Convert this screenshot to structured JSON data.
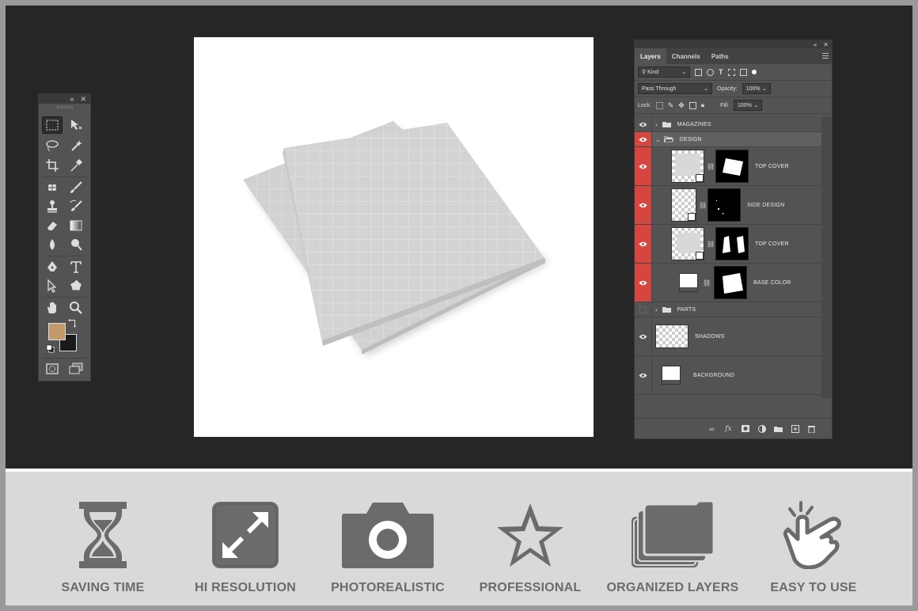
{
  "toolbox": {
    "collapse_icon": "double-chevron-icon",
    "close_icon": "close-icon",
    "foreground_color": "#c49a6c",
    "background_color": "#1a1a1a"
  },
  "layers_panel": {
    "tabs": [
      {
        "label": "Layers",
        "active": true
      },
      {
        "label": "Channels",
        "active": false
      },
      {
        "label": "Paths",
        "active": false
      }
    ],
    "filter_kind": "Kind",
    "blend_mode": "Pass Through",
    "opacity_label": "Opacity:",
    "opacity_value": "100%",
    "lock_label": "Lock:",
    "fill_label": "Fill:",
    "fill_value": "100%",
    "layers": [
      {
        "name": "MAGAZINES",
        "type": "group",
        "open": false,
        "visible": true
      },
      {
        "name": "DESIGN",
        "type": "group",
        "open": true,
        "visible": true
      },
      {
        "name": "TOP COVER",
        "type": "smart",
        "visible": true
      },
      {
        "name": "SIDE DESIGN",
        "type": "smart",
        "visible": true
      },
      {
        "name": "TOP COVER",
        "type": "smart",
        "visible": true
      },
      {
        "name": "BASE COLOR",
        "type": "fill",
        "visible": true
      },
      {
        "name": "PARTS",
        "type": "group",
        "open": false,
        "visible": false
      },
      {
        "name": "SHADOWS",
        "type": "layer",
        "visible": true
      },
      {
        "name": "BACKGROUND",
        "type": "fill",
        "visible": true
      }
    ],
    "accent_color": "#d4463f"
  },
  "features": [
    {
      "label": "SAVING TIME",
      "icon": "hourglass-icon"
    },
    {
      "label": "HI RESOLUTION",
      "icon": "expand-arrows-icon"
    },
    {
      "label": "PHOTOREALISTIC",
      "icon": "camera-icon"
    },
    {
      "label": "PROFESSIONAL",
      "icon": "star-icon"
    },
    {
      "label": "ORGANIZED LAYERS",
      "icon": "stacked-layers-icon"
    },
    {
      "label": "EASY TO USE",
      "icon": "pointing-hand-icon"
    }
  ]
}
